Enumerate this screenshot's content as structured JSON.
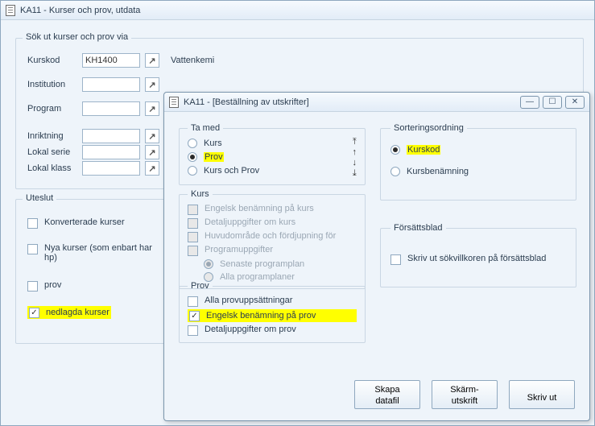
{
  "main": {
    "title": "KA11 - Kurser och prov, utdata",
    "search_group": "Sök ut kurser och prov via",
    "exclude_group": "Uteslut",
    "fields": {
      "kurskod_label": "Kurskod",
      "kurskod_value": "KH1400",
      "kurskod_display": "Vattenkemi",
      "institution_label": "Institution",
      "institution_value": "",
      "program_label": "Program",
      "program_value": "",
      "inriktning_label": "Inriktning",
      "inriktning_value": "",
      "lokal_serie_label": "Lokal serie",
      "lokal_serie_value": "",
      "lokal_klass_label": "Lokal klass",
      "lokal_klass_value": ""
    },
    "exclude": {
      "konverterade": "Konverterade kurser",
      "nya_kurser": "Nya kurser (som enbart har hp)",
      "prov": "prov",
      "nedlagda": "nedlagda kurser"
    }
  },
  "dialog": {
    "title": "KA11 - [Beställning av utskrifter]",
    "ta_med": {
      "legend": "Ta med",
      "kurs": "Kurs",
      "prov": "Prov",
      "kurs_och_prov": "Kurs och Prov"
    },
    "kurs_section": {
      "legend": "Kurs",
      "eng_ben_kurs": "Engelsk benämning på kurs",
      "detalj_kurs": "Detaljuppgifter om kurs",
      "huvudomrade": "Huvudområde och fördjupning för",
      "programuppgifter": "Programuppgifter",
      "senaste_plan": "Senaste programplan",
      "alla_planer": "Alla programplaner"
    },
    "prov_section": {
      "legend": "Prov",
      "alla_provupps": "Alla provuppsättningar",
      "eng_ben_prov": "Engelsk benämning på prov",
      "detalj_prov": "Detaljuppgifter om prov"
    },
    "sort": {
      "legend": "Sorteringsordning",
      "kurskod": "Kurskod",
      "kursbenamning": "Kursbenämning"
    },
    "forsattsblad": {
      "legend": "Försättsblad",
      "skriv_sok": "Skriv ut sökvillkoren på försättsblad"
    },
    "buttons": {
      "datafil": "Skapa\ndatafil",
      "skarm": "Skärm-\nutskrift",
      "skriv_ut": "Skriv ut"
    }
  }
}
